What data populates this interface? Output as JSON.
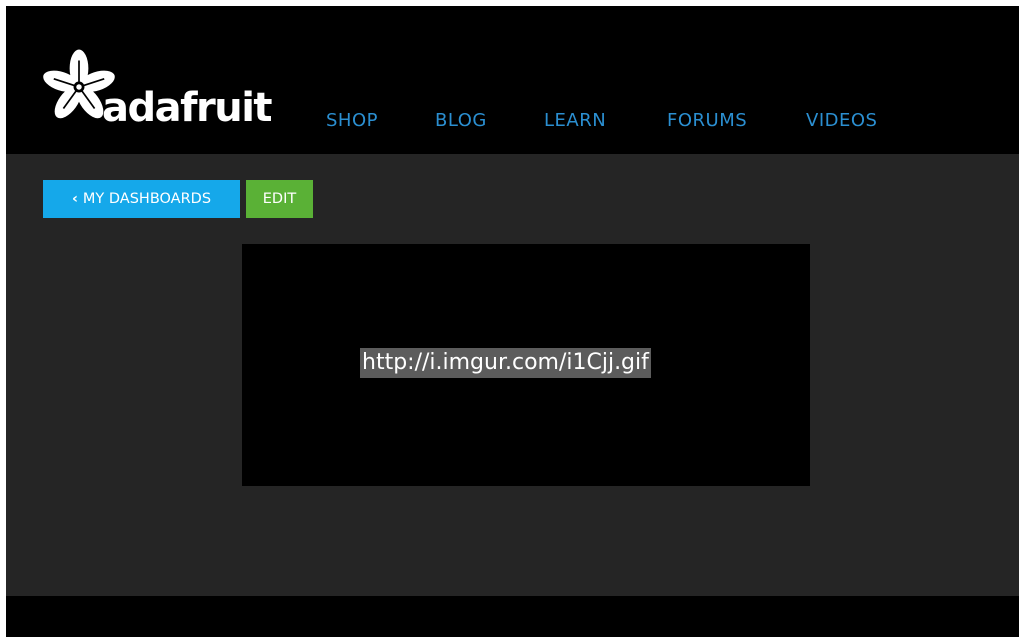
{
  "header": {
    "brand": "adafruit",
    "logo_icon": "adafruit-flower-logo",
    "nav": [
      {
        "label": "SHOP"
      },
      {
        "label": "BLOG"
      },
      {
        "label": "LEARN"
      },
      {
        "label": "FORUMS"
      },
      {
        "label": "VIDEOS"
      }
    ]
  },
  "toolbar": {
    "dashboards_label": "MY DASHBOARDS",
    "dashboards_icon": "chevron-left-icon",
    "edit_label": "EDIT"
  },
  "block": {
    "text": "http://i.imgur.com/i1Cjj.gif"
  },
  "colors": {
    "nav_link": "#2b8fd1",
    "dashboards_button": "#15a8ea",
    "edit_button": "#5ab136",
    "content_background": "#252525",
    "header_background": "#000000",
    "text_highlight": "#5c5c5c"
  }
}
